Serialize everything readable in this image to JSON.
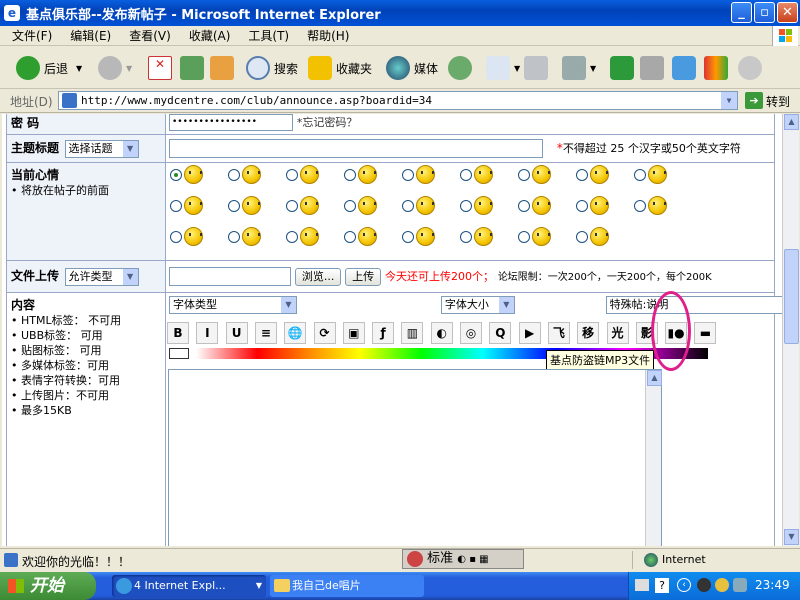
{
  "window": {
    "title": "基点俱乐部--发布新帖子 - Microsoft Internet Explorer",
    "minimize": "_",
    "maximize": "▫",
    "close": "✕"
  },
  "menu": [
    "文件(F)",
    "编辑(E)",
    "查看(V)",
    "收藏(A)",
    "工具(T)",
    "帮助(H)"
  ],
  "toolbar": {
    "back": "后退",
    "search": "搜索",
    "favorites": "收藏夹",
    "media": "媒体"
  },
  "address": {
    "label": "地址(D)",
    "url": "http://www.mydcentre.com/club/announce.asp?boardid=34",
    "go": "转到"
  },
  "form": {
    "password": {
      "label": "密 码",
      "value": "••••••••••••••••",
      "hint": "*忘记密码？"
    },
    "subject": {
      "label": "主题标题",
      "topic_select": "选择话题",
      "note_star": "*",
      "note": "不得超过 25 个汉字或50个英文字符"
    },
    "mood": {
      "label": "当前心情",
      "sub": "将放在帖子的前面",
      "rows": [
        9,
        9,
        8
      ]
    },
    "upload": {
      "label": "文件上传",
      "select": "允许类型",
      "browse": "浏览...",
      "upload_btn": "上传",
      "notice_red": "今天还可上传200个；",
      "notice": "论坛限制：一次200个，一天200个，每个200K"
    },
    "content": {
      "label": "内容",
      "items": [
        "HTML标签： 不可用",
        "UBB标签： 可用",
        "贴图标签： 可用",
        "多媒体标签：可用",
        "表情字符转换：可用",
        "上传图片：不可用",
        "最多15KB"
      ],
      "font_type": "字体类型",
      "font_size": "字体大小",
      "special": "特殊帖:说明",
      "buttons": [
        "B",
        "I",
        "U",
        "≡",
        "🌐",
        "⟳",
        "▣",
        "ƒ",
        "▥",
        "◐",
        "◎",
        "Q",
        "▶",
        "飞",
        "移",
        "光",
        "影",
        "▮●",
        "▬"
      ],
      "tooltip": "基点防盗链MP3文件"
    }
  },
  "status": {
    "text": "欢迎你的光临！！！",
    "zone": "Internet",
    "ime": "标准"
  },
  "taskbar": {
    "start": "开始",
    "tasks": [
      "4 Internet Expl...",
      "我自己de唱片"
    ],
    "clock": "23:49"
  },
  "colors": {
    "titlebar": "#0A5FE0",
    "label_bg": "#EEF3FA",
    "red_text": "#FF0000",
    "highlight_circle": "#E0208A"
  }
}
